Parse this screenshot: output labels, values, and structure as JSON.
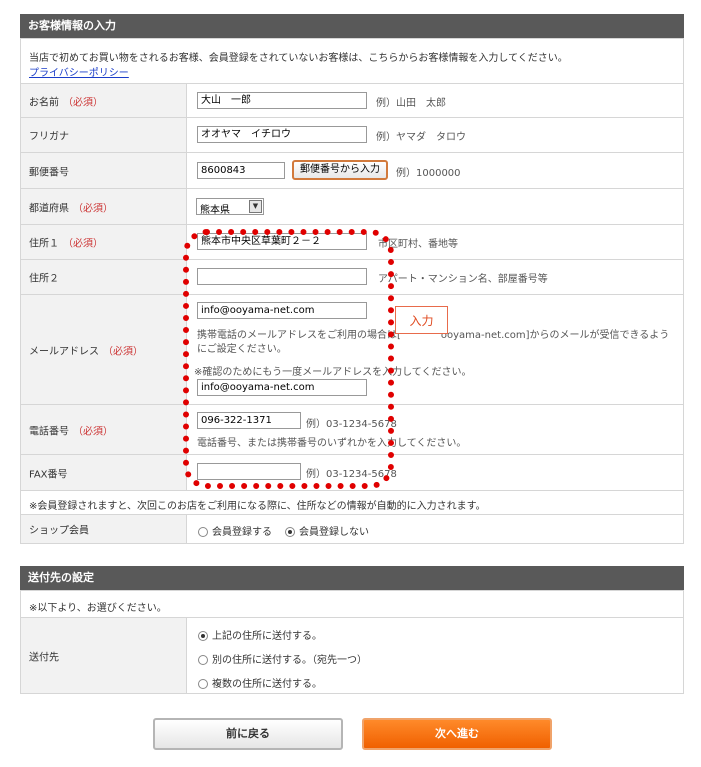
{
  "customer": {
    "header": "お客様情報の入力",
    "intro": "当店で初めてお買い物をされるお客様、会員登録をされていないお客様は、こちらからお客様情報を入力してください。",
    "privacy_link": "プライバシーポリシー",
    "required": "（必須）",
    "name": {
      "label": "お名前",
      "value": "大山　一郎",
      "example": "例）山田　太郎"
    },
    "kana": {
      "label": "フリガナ",
      "value": "オオヤマ　イチロウ",
      "example": "例）ヤマダ　タロウ"
    },
    "zip": {
      "label": "郵便番号",
      "value": "8600843",
      "button": "郵便番号から入力",
      "example": "例）1000000"
    },
    "pref": {
      "label": "都道府県",
      "value": "熊本県"
    },
    "addr1": {
      "label": "住所１",
      "value": "熊本市中央区草葉町２－２",
      "hint": "市区町村、番地等"
    },
    "addr2": {
      "label": "住所２",
      "value": "",
      "hint": "アパート・マンション名、部屋番号等"
    },
    "email": {
      "label": "メールアドレス",
      "value": "info@ooyama-net.com",
      "hint1": "携帯電話のメールアドレスをご利用の場合は[　　　　ooyama-net.com]からのメールが受信できるよう",
      "hint2": "にご設定ください。",
      "confirm_hint": "※確認のためにもう一度メールアドレスを入力してください。",
      "confirm_value": "info@ooyama-net.com"
    },
    "tel": {
      "label": "電話番号",
      "value": "096-322-1371",
      "example": "例）03-1234-5678",
      "hint": "電話番号、または携帯番号のいずれかを入力してください。"
    },
    "fax": {
      "label": "FAX番号",
      "value": "",
      "example": "例）03-1234-5678"
    },
    "member_note": "※会員登録されますと、次回このお店をご利用になる際に、住所などの情報が自動的に入力されます。",
    "shop_member": {
      "label": "ショップ会員",
      "opt1": "会員登録する",
      "opt2": "会員登録しない"
    }
  },
  "callout": "入力",
  "delivery": {
    "header": "送付先の設定",
    "note": "※以下より、お選びください。",
    "label": "送付先",
    "opt1": "上記の住所に送付する。",
    "opt2": "別の住所に送付する。（宛先一つ）",
    "opt3": "複数の住所に送付する。"
  },
  "buttons": {
    "back": "前に戻る",
    "next": "次へ進む"
  }
}
